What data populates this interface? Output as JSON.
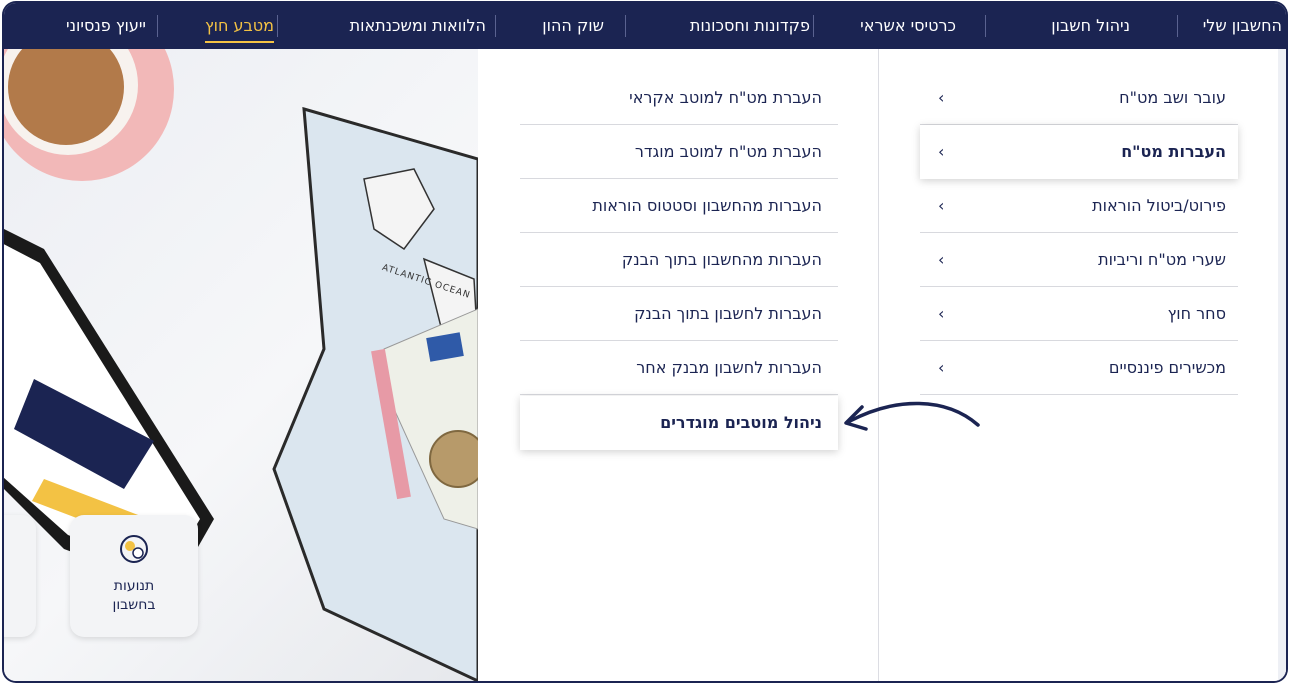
{
  "nav": {
    "items": [
      "החשבון שלי",
      "ניהול חשבון",
      "כרטיסי אשראי",
      "פקדונות וחסכונות",
      "שוק ההון",
      "הלוואות ומשכנתאות",
      "מטבע חוץ",
      "ייעוץ פנסיוני"
    ],
    "active": "מטבע חוץ"
  },
  "menu": {
    "right_items": [
      "עובר ושב מט\"ח",
      "העברות מט\"ח",
      "פירוט/ביטול הוראות",
      "שערי מט\"ח וריביות",
      "סחר חוץ",
      "מכשירים פיננסיים"
    ],
    "selected": "העברות מט\"ח",
    "left_items": [
      "העברת מט\"ח למוטב אקראי",
      "העברת מט\"ח למוטב מוגדר",
      "העברות מהחשבון וסטטוס הוראות",
      "העברות מהחשבון בתוך הבנק",
      "העברות לחשבון בתוך הבנק",
      "העברות לחשבון מבנק אחר",
      "ניהול מוטבים מוגדרים"
    ],
    "highlighted": "ניהול מוטבים מוגדרים",
    "chevron_glyph": "‹"
  },
  "background": {
    "tile_label_line1": "תנועות",
    "tile_label_line2": "בחשבון",
    "map_label": "ATLANTIC OCEAN"
  },
  "colors": {
    "nav_bg": "#1b2452",
    "active_accent": "#f3c244",
    "text_navy": "#1b2452"
  },
  "icons": [
    "chevron-left-icon",
    "arrow-annotation-icon",
    "coin-icon"
  ]
}
